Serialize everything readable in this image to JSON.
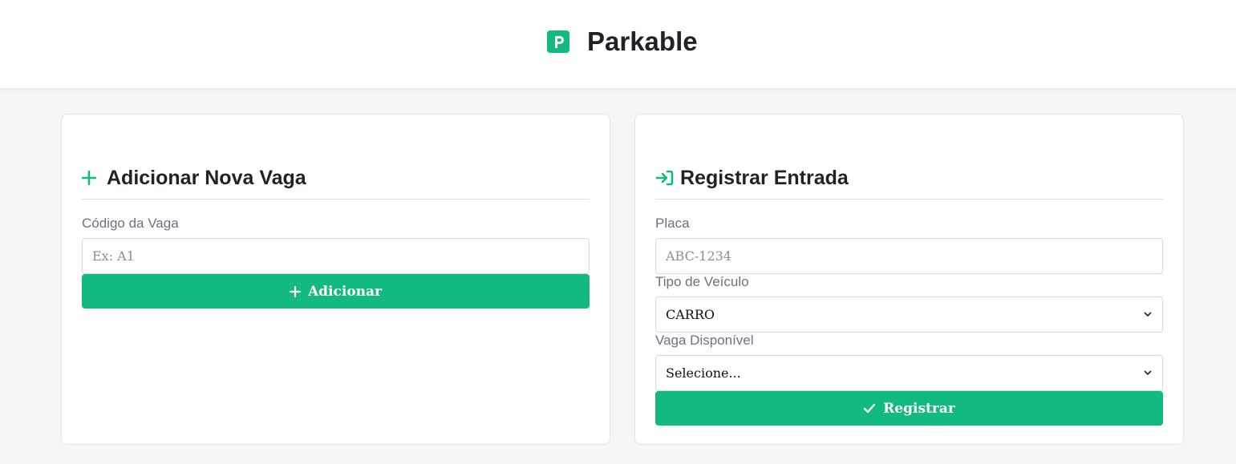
{
  "brand": {
    "name": "Parkable",
    "logo_letter": "P",
    "accent_color": "#12b981"
  },
  "add_spot": {
    "title": "Adicionar Nova Vaga",
    "title_icon": "plus-icon",
    "code_label": "Código da Vaga",
    "code_placeholder": "Ex: A1",
    "submit_label": "Adicionar",
    "submit_icon": "plus-icon"
  },
  "entry": {
    "title": "Registrar Entrada",
    "title_icon": "sign-in-icon",
    "plate_label": "Placa",
    "plate_placeholder": "ABC-1234",
    "vehicle_type_label": "Tipo de Veículo",
    "vehicle_type_value": "CARRO",
    "spot_label": "Vaga Disponível",
    "spot_value": "Selecione...",
    "submit_label": "Registrar",
    "submit_icon": "check-icon"
  }
}
